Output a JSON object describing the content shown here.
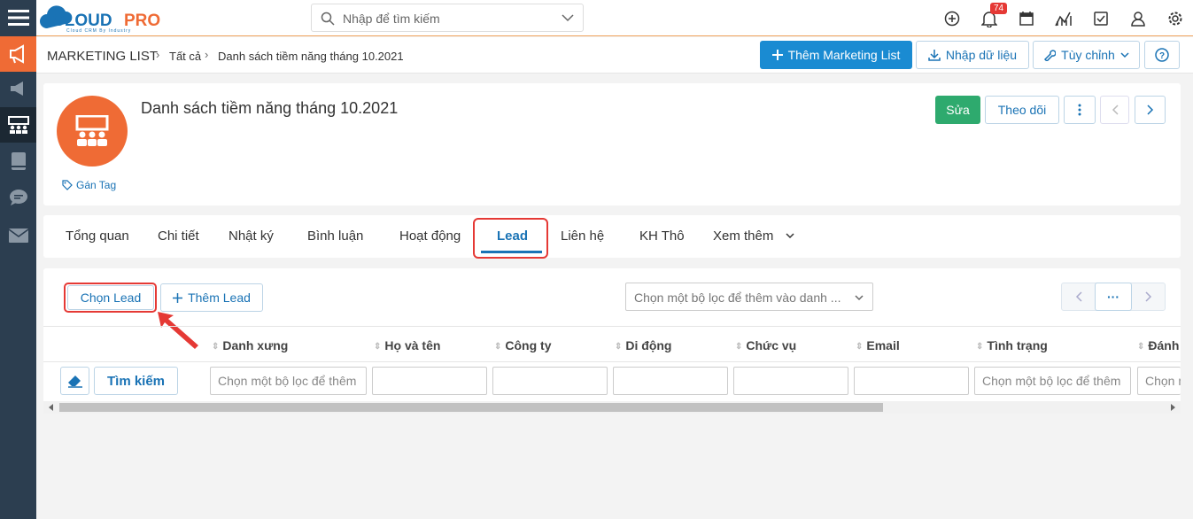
{
  "topbar": {
    "logo": {
      "part1": "CLOUD",
      "part2": "PRO",
      "tagline": "Cloud CRM By Industry"
    },
    "search_placeholder": "Nhập để tìm kiếm",
    "notification_count": "74"
  },
  "breadcrumb": {
    "module": "MARKETING LIST",
    "level1": "Tất cả",
    "level2": "Danh sách tiềm năng tháng 10.2021"
  },
  "header_actions": {
    "add": "Thêm Marketing List",
    "import": "Nhập dữ liệu",
    "customize": "Tùy chỉnh"
  },
  "record": {
    "title": "Danh sách tiềm năng tháng 10.2021",
    "tag_label": "Gán Tag",
    "edit": "Sửa",
    "follow": "Theo dõi"
  },
  "tabs": [
    "Tổng quan",
    "Chi tiết",
    "Nhật ký",
    "Bình luận",
    "Hoạt động",
    "Lead",
    "Liên hệ",
    "KH Thô",
    "Xem thêm"
  ],
  "lead_panel": {
    "choose_lead": "Chọn Lead",
    "add_lead": "Thêm Lead",
    "filter_placeholder": "Chọn một bộ lọc để thêm vào danh ...",
    "more": "···",
    "columns": [
      "Danh xưng",
      "Họ và tên",
      "Công ty",
      "Di động",
      "Chức vụ",
      "Email",
      "Tình trạng",
      "Đánh"
    ],
    "search_button": "Tìm kiếm",
    "filter_ph_1": "Chọn một bộ lọc để thêm",
    "filter_ph_2": "Chọn một bộ lọc để thêm",
    "filter_ph_3": "Chọn m"
  },
  "colors": {
    "sidebar": "#2c3e50",
    "sidebar_active": "#ef6b35",
    "primary": "#1a8bd2",
    "success": "#2eaa6e",
    "highlight": "#e53935"
  }
}
